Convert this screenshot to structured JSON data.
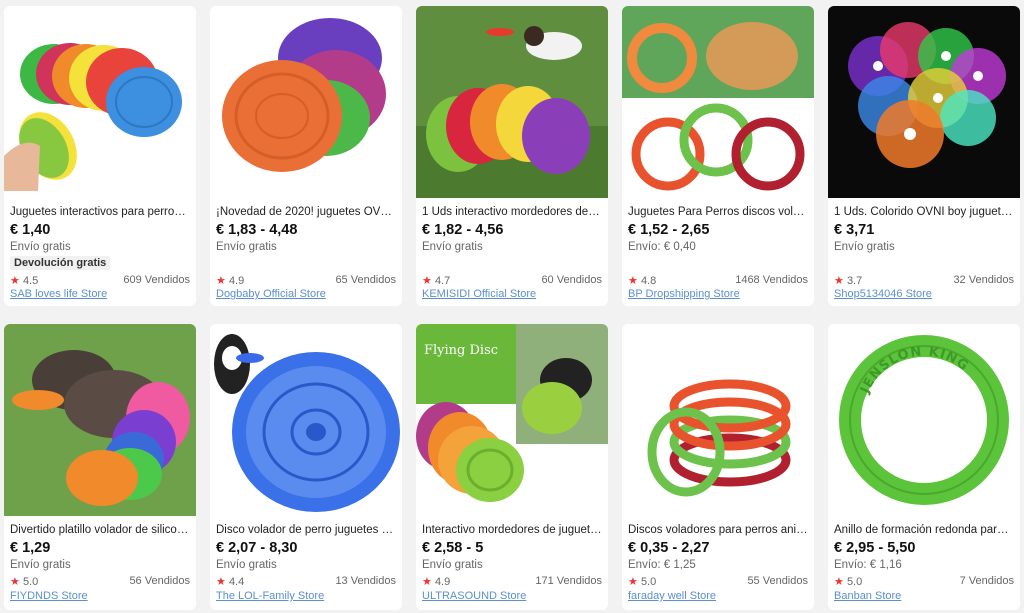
{
  "products": [
    {
      "title": "Juguetes interactivos para perros ...",
      "price": "€ 1,40",
      "shipping": "Envío gratis",
      "badge": "Devolución gratis",
      "rating": "4.5",
      "sold": "609 Vendidos",
      "store": "SAB loves life Store",
      "image": "stacked-frisbees-hand"
    },
    {
      "title": "¡Novedad de 2020! juguetes OVNI ...",
      "price": "€ 1,83 - 4,48",
      "shipping": "Envío gratis",
      "rating": "4.9",
      "sold": "65 Vendidos",
      "store": "Dogbaby Official Store",
      "image": "rubber-frisbees"
    },
    {
      "title": "1 Uds interactivo mordedores de j...",
      "price": "€ 1,82 - 4,56",
      "shipping": "Envío gratis",
      "rating": "4.7",
      "sold": "60 Vendidos",
      "store": "KEMISIDI Official Store",
      "image": "dog-jumping-frisbee"
    },
    {
      "title": "Juguetes Para Perros discos volad...",
      "price": "€ 1,52 - 2,65",
      "shipping": "Envío: € 0,40",
      "rating": "4.8",
      "sold": "1468 Vendidos",
      "store": "BP Dropshipping Store",
      "image": "dog-rings"
    },
    {
      "title": "1 Uds. Colorido OVNI boy juguete ...",
      "price": "€ 3,71",
      "shipping": "Envío gratis",
      "rating": "3.7",
      "sold": "32 Vendidos",
      "store": "Shop5134046 Store",
      "image": "led-frisbees"
    },
    {
      "title": "Divertido platillo volador de silicon...",
      "price": "€ 1,29",
      "shipping": "Envío gratis",
      "rating": "5.0",
      "sold": "56 Vendidos",
      "store": "FIYDNDS Store",
      "image": "terrier-frisbee"
    },
    {
      "title": "Disco volador de perro juguetes d...",
      "price": "€ 2,07 - 8,30",
      "shipping": "Envío gratis",
      "rating": "4.4",
      "sold": "13 Vendidos",
      "store": "The LOL-Family Store",
      "image": "blue-frisbee"
    },
    {
      "title": "Interactivo mordedores de juguete...",
      "price": "€ 2,58 - 5",
      "shipping": "Envío gratis",
      "rating": "4.9",
      "sold": "171 Vendidos",
      "store": "ULTRASOUND Store",
      "image": "flying-disc",
      "image_text": "Flying Disc"
    },
    {
      "title": "Discos voladores para perros anill...",
      "price": "€ 0,35 - 2,27",
      "shipping": "Envío: € 1,25",
      "rating": "5.0",
      "sold": "55 Vendidos",
      "store": "faraday well Store",
      "image": "stacked-rings"
    },
    {
      "title": "Anillo de formación redonda para ...",
      "price": "€ 2,95 - 5,50",
      "shipping": "Envío: € 1,16",
      "rating": "5.0",
      "sold": "7 Vendidos",
      "store": "Banban Store",
      "image": "green-ring",
      "image_text": "JENSLON KING"
    }
  ],
  "colors": {
    "star": "#e33333",
    "store_link": "#5a8fd0",
    "background": "#f2f2f2"
  }
}
